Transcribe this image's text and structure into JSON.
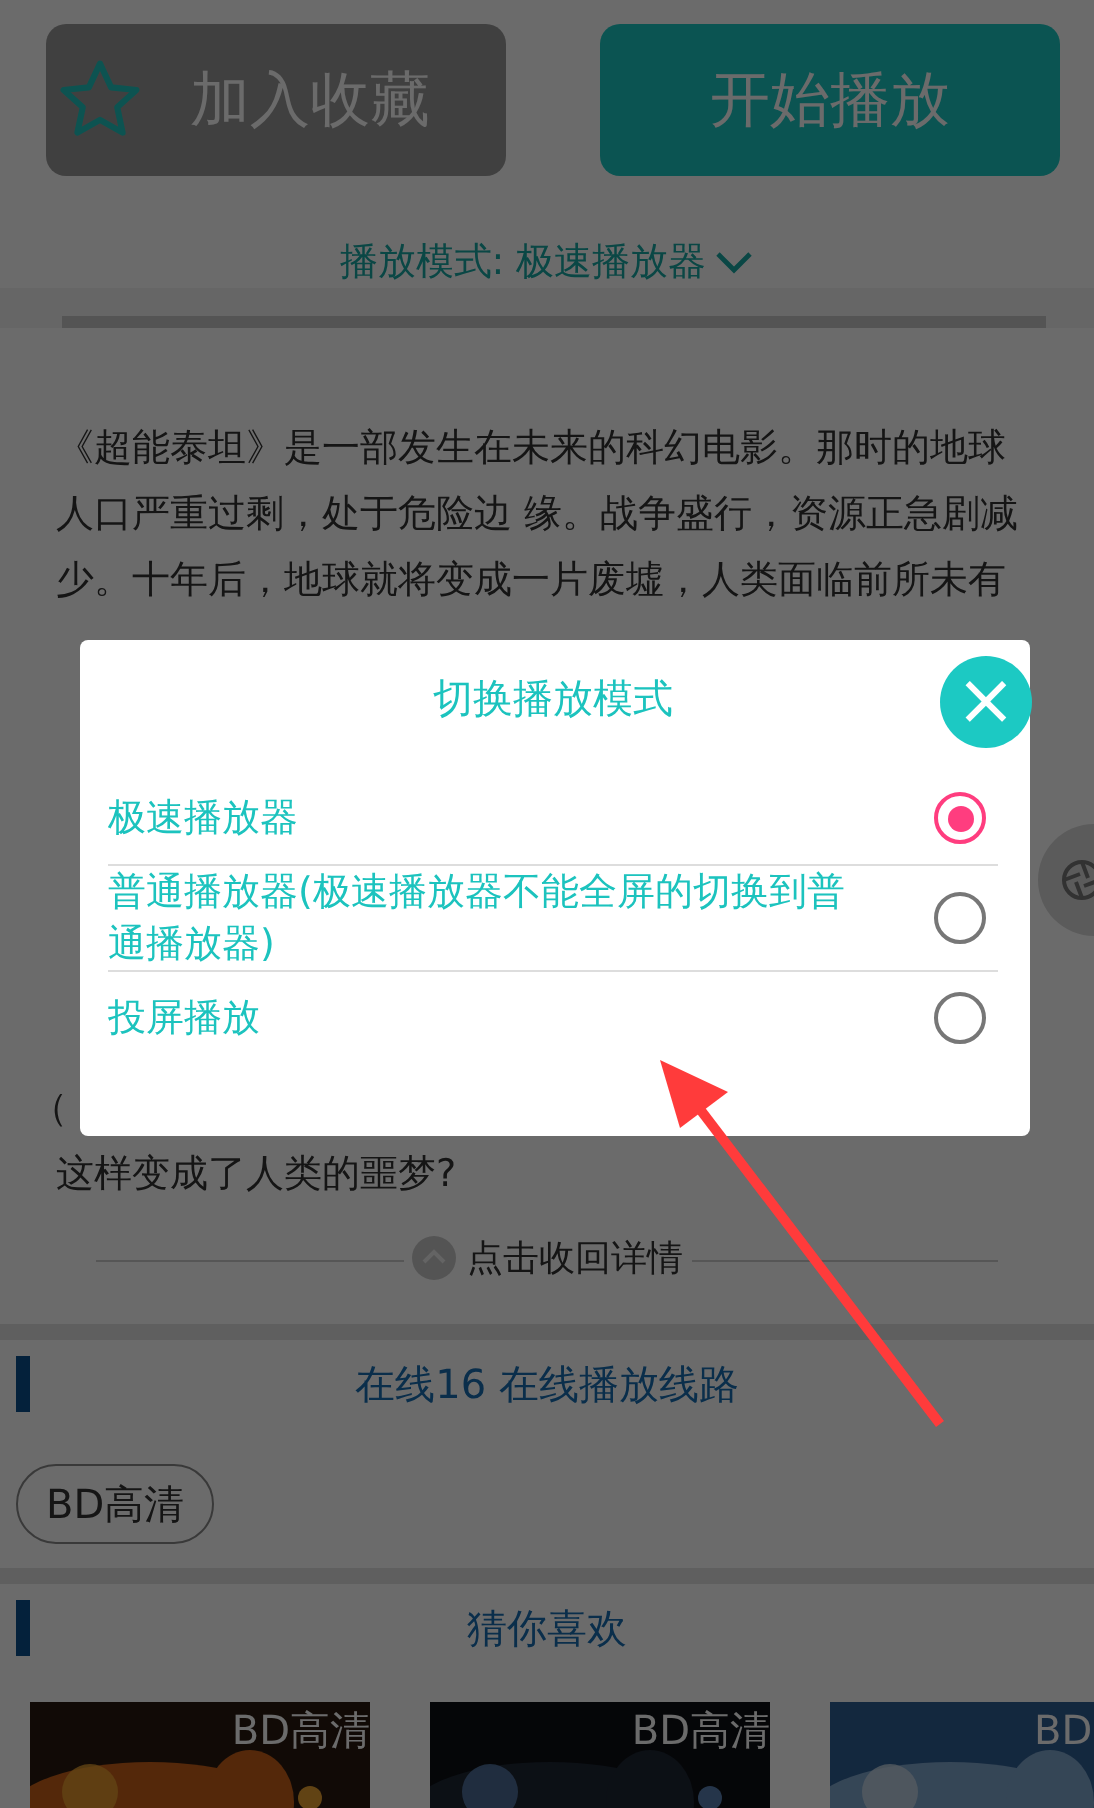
{
  "actions": [
    {
      "kind": "favorite",
      "label": "加入收藏"
    },
    {
      "kind": "play",
      "label": "开始播放"
    }
  ],
  "play_mode": {
    "label": "播放模式: 极速播放器"
  },
  "synopsis": {
    "lines": [
      "《超能泰坦》是一部发生在未来的科幻电影。那时的地球",
      "人口严重过剩，处于危险边 缘。战争盛行，资源正急剧减",
      "少。十年后，地球就将变成一片废墟，人类面临前所未有"
    ],
    "lines_below": [
      "（",
      "这样变成了人类的噩梦?"
    ],
    "collapse": "点击收回详情"
  },
  "line_section": {
    "title": "在线16 在线播放线路",
    "sources": [
      {
        "label": "BD高清",
        "selected": false
      }
    ]
  },
  "recommend": {
    "title": "猜你喜欢",
    "posters": [
      {
        "badge": "BD高清"
      },
      {
        "badge": "BD高清"
      },
      {
        "badge": "BD"
      }
    ]
  },
  "dialog": {
    "title": "切换播放模式",
    "close": "×",
    "options": [
      {
        "label": "极速播放器",
        "selected": true
      },
      {
        "label": "普通播放器(极速播放器不能全屏的切换到普通播放器)",
        "selected": false
      },
      {
        "label": "投屏播放",
        "selected": false
      }
    ]
  }
}
